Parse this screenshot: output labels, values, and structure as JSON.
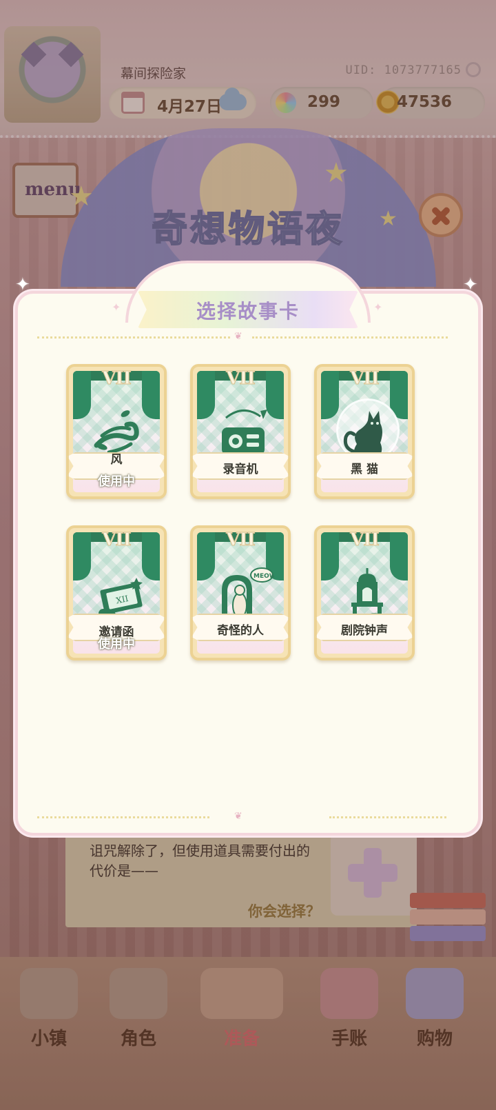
{
  "header": {
    "player_name": "幕间探险家",
    "uid": "UID: 1073777165",
    "date": "4月27日",
    "gems": "299",
    "coins": "47536"
  },
  "background": {
    "menu_sign": "menu",
    "event_title": "奇想物语夜",
    "story_text": "诅咒解除了，但使用道具需要付出的代价是——",
    "story_choice": "你会选择？"
  },
  "modal": {
    "title": "选择故事卡",
    "cards": [
      {
        "numeral": "VII",
        "name": "风",
        "status": "使用中",
        "icon": "wind-icon"
      },
      {
        "numeral": "VII",
        "name": "录音机",
        "status": "",
        "icon": "radio-icon"
      },
      {
        "numeral": "VII",
        "name": "黑 猫",
        "status": "",
        "icon": "black-cat-icon"
      },
      {
        "numeral": "VII",
        "name": "邀请函",
        "status": "使用中",
        "icon": "invitation-icon"
      },
      {
        "numeral": "VII",
        "name": "奇怪的人",
        "status": "",
        "icon": "strange-person-icon"
      },
      {
        "numeral": "VII",
        "name": "剧院钟声",
        "status": "",
        "icon": "theater-bell-icon"
      }
    ]
  },
  "bottom_nav": {
    "items": [
      {
        "label": "小镇",
        "icon": "map-icon"
      },
      {
        "label": "角色",
        "icon": "character-icon"
      },
      {
        "label": "准备",
        "icon": "prepare-icon",
        "active": true
      },
      {
        "label": "手账",
        "icon": "notebook-icon"
      },
      {
        "label": "购物",
        "icon": "shopping-bag-icon"
      }
    ]
  },
  "colors": {
    "card_green": "#2f8a62",
    "title_purple": "#a78ec7",
    "modal_bg": "#fdfbf0",
    "active_nav": "#d86c6c"
  }
}
